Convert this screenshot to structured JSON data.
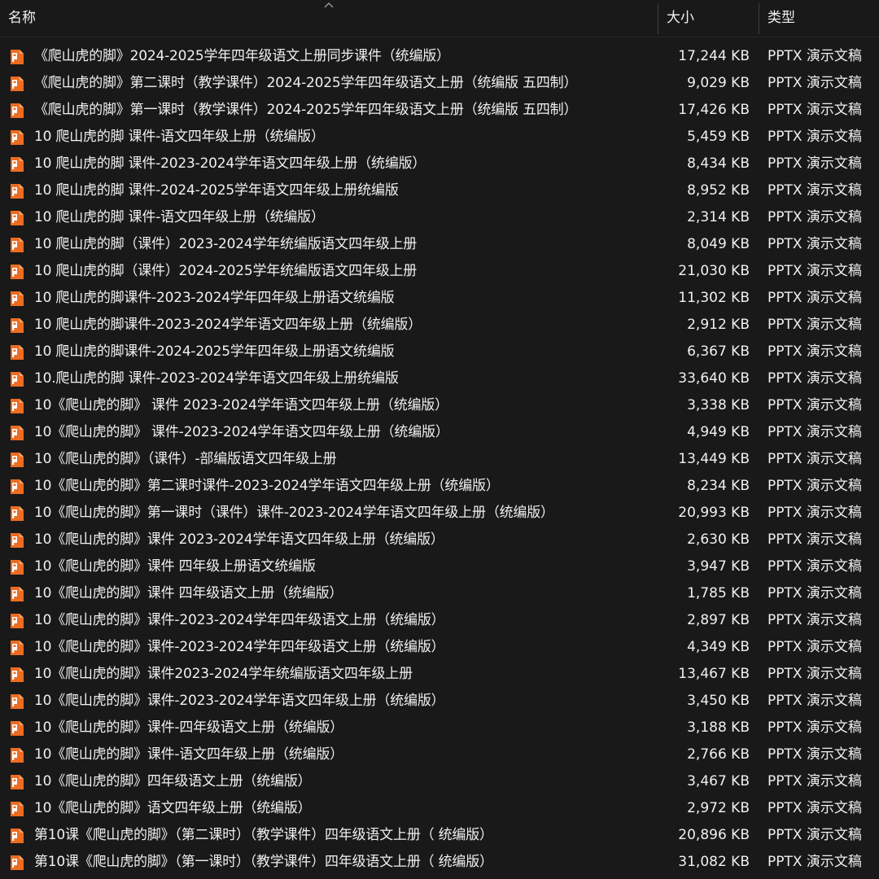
{
  "header": {
    "name_label": "名称",
    "size_label": "大小",
    "type_label": "类型"
  },
  "colors": {
    "background": "#191919",
    "icon_orange": "#ED6C21",
    "text": "#f0f0f0"
  },
  "files": [
    {
      "name": "《爬山虎的脚》2024-2025学年四年级语文上册同步课件（统编版）",
      "size": "17,244 KB",
      "type": "PPTX 演示文稿",
      "icon": "pptx-icon"
    },
    {
      "name": "《爬山虎的脚》第二课时（教学课件）2024-2025学年四年级语文上册（统编版 五四制）",
      "size": "9,029 KB",
      "type": "PPTX 演示文稿",
      "icon": "pptx-icon"
    },
    {
      "name": "《爬山虎的脚》第一课时（教学课件）2024-2025学年四年级语文上册（统编版 五四制）",
      "size": "17,426 KB",
      "type": "PPTX 演示文稿",
      "icon": "pptx-icon"
    },
    {
      "name": "10  爬山虎的脚 课件-语文四年级上册（统编版）",
      "size": "5,459 KB",
      "type": "PPTX 演示文稿",
      "icon": "pptx-icon"
    },
    {
      "name": "10 爬山虎的脚 课件-2023-2024学年语文四年级上册（统编版）",
      "size": "8,434 KB",
      "type": "PPTX 演示文稿",
      "icon": "pptx-icon"
    },
    {
      "name": "10 爬山虎的脚 课件-2024-2025学年语文四年级上册统编版",
      "size": "8,952 KB",
      "type": "PPTX 演示文稿",
      "icon": "pptx-icon"
    },
    {
      "name": "10 爬山虎的脚 课件-语文四年级上册（统编版）",
      "size": "2,314 KB",
      "type": "PPTX 演示文稿",
      "icon": "pptx-icon"
    },
    {
      "name": "10 爬山虎的脚（课件）2023-2024学年统编版语文四年级上册",
      "size": "8,049 KB",
      "type": "PPTX 演示文稿",
      "icon": "pptx-icon"
    },
    {
      "name": "10 爬山虎的脚（课件）2024-2025学年统编版语文四年级上册",
      "size": "21,030 KB",
      "type": "PPTX 演示文稿",
      "icon": "pptx-icon"
    },
    {
      "name": "10 爬山虎的脚课件-2023-2024学年四年级上册语文统编版",
      "size": "11,302 KB",
      "type": "PPTX 演示文稿",
      "icon": "pptx-icon"
    },
    {
      "name": "10 爬山虎的脚课件-2023-2024学年语文四年级上册（统编版）",
      "size": "2,912 KB",
      "type": "PPTX 演示文稿",
      "icon": "pptx-icon"
    },
    {
      "name": "10 爬山虎的脚课件-2024-2025学年四年级上册语文统编版",
      "size": "6,367 KB",
      "type": "PPTX 演示文稿",
      "icon": "pptx-icon"
    },
    {
      "name": "10.爬山虎的脚 课件-2023-2024学年语文四年级上册统编版",
      "size": "33,640 KB",
      "type": "PPTX 演示文稿",
      "icon": "pptx-icon"
    },
    {
      "name": "10《爬山虎的脚》 课件 2023-2024学年语文四年级上册（统编版）",
      "size": "3,338 KB",
      "type": "PPTX 演示文稿",
      "icon": "pptx-icon"
    },
    {
      "name": "10《爬山虎的脚》 课件-2023-2024学年语文四年级上册（统编版）",
      "size": "4,949 KB",
      "type": "PPTX 演示文稿",
      "icon": "pptx-icon"
    },
    {
      "name": "10《爬山虎的脚》（课件）-部编版语文四年级上册",
      "size": "13,449 KB",
      "type": "PPTX 演示文稿",
      "icon": "pptx-icon"
    },
    {
      "name": "10《爬山虎的脚》第二课时课件-2023-2024学年语文四年级上册（统编版）",
      "size": "8,234 KB",
      "type": "PPTX 演示文稿",
      "icon": "pptx-icon"
    },
    {
      "name": "10《爬山虎的脚》第一课时（课件）课件-2023-2024学年语文四年级上册（统编版）",
      "size": "20,993 KB",
      "type": "PPTX 演示文稿",
      "icon": "pptx-icon"
    },
    {
      "name": "10《爬山虎的脚》课件 2023-2024学年语文四年级上册（统编版）",
      "size": "2,630 KB",
      "type": "PPTX 演示文稿",
      "icon": "pptx-icon"
    },
    {
      "name": "10《爬山虎的脚》课件 四年级上册语文统编版",
      "size": "3,947 KB",
      "type": "PPTX 演示文稿",
      "icon": "pptx-icon"
    },
    {
      "name": "10《爬山虎的脚》课件 四年级语文上册（统编版）",
      "size": "1,785 KB",
      "type": "PPTX 演示文稿",
      "icon": "pptx-icon"
    },
    {
      "name": "10《爬山虎的脚》课件-2023-2024学年四年级语文上册（统编版）",
      "size": "2,897 KB",
      "type": "PPTX 演示文稿",
      "icon": "pptx-icon"
    },
    {
      "name": "10《爬山虎的脚》课件-2023-2024学年四年级语文上册（统编版）",
      "size": "4,349 KB",
      "type": "PPTX 演示文稿",
      "icon": "pptx-icon"
    },
    {
      "name": "10《爬山虎的脚》课件2023-2024学年统编版语文四年级上册",
      "size": "13,467 KB",
      "type": "PPTX 演示文稿",
      "icon": "pptx-icon"
    },
    {
      "name": "10《爬山虎的脚》课件-2023-2024学年语文四年级上册（统编版）",
      "size": "3,450 KB",
      "type": "PPTX 演示文稿",
      "icon": "pptx-icon"
    },
    {
      "name": "10《爬山虎的脚》课件-四年级语文上册（统编版）",
      "size": "3,188 KB",
      "type": "PPTX 演示文稿",
      "icon": "pptx-icon"
    },
    {
      "name": "10《爬山虎的脚》课件-语文四年级上册（统编版）",
      "size": "2,766 KB",
      "type": "PPTX 演示文稿",
      "icon": "pptx-icon"
    },
    {
      "name": "10《爬山虎的脚》四年级语文上册（统编版）",
      "size": "3,467 KB",
      "type": "PPTX 演示文稿",
      "icon": "pptx-icon"
    },
    {
      "name": "10《爬山虎的脚》语文四年级上册（统编版）",
      "size": "2,972 KB",
      "type": "PPTX 演示文稿",
      "icon": "pptx-icon"
    },
    {
      "name": "第10课《爬山虎的脚》（第二课时）（教学课件）四年级语文上册（ 统编版）",
      "size": "20,896 KB",
      "type": "PPTX 演示文稿",
      "icon": "pptx-icon"
    },
    {
      "name": "第10课《爬山虎的脚》（第一课时）（教学课件）四年级语文上册（ 统编版）",
      "size": "31,082 KB",
      "type": "PPTX 演示文稿",
      "icon": "pptx-icon"
    }
  ]
}
